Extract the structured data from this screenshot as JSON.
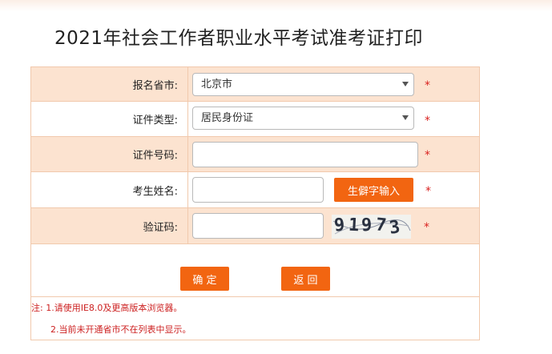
{
  "page_title": "2021年社会工作者职业水平考试准考证打印",
  "form": {
    "province": {
      "label": "报名省市:",
      "value": "北京市"
    },
    "id_type": {
      "label": "证件类型:",
      "value": "居民身份证"
    },
    "id_number": {
      "label": "证件号码:",
      "value": ""
    },
    "name": {
      "label": "考生姓名:",
      "value": "",
      "rare_char_button": "生僻字输入"
    },
    "captcha": {
      "label": "验证码:",
      "value": "",
      "image_text": [
        "9",
        "1",
        "9",
        "7",
        "3"
      ]
    },
    "required_mark": "*"
  },
  "buttons": {
    "confirm": "确 定",
    "back": "返 回"
  },
  "notes": {
    "line1": "注: 1.请使用IE8.0及更高版本浏览器。",
    "line2": "2.当前未开通省市不在列表中显示。"
  }
}
